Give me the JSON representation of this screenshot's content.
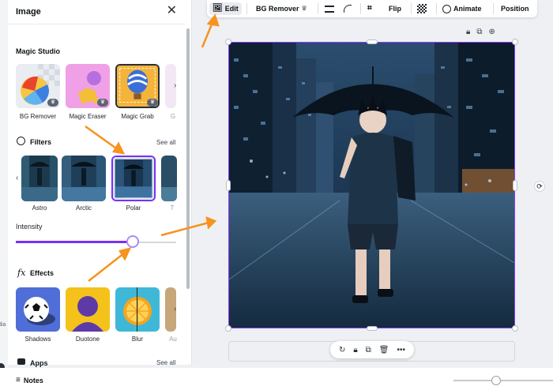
{
  "panel": {
    "title": "Image",
    "close_icon": "close-icon",
    "magic_studio": {
      "heading": "Magic Studio",
      "items": [
        {
          "label": "BG Remover"
        },
        {
          "label": "Magic Eraser"
        },
        {
          "label": "Magic Grab"
        },
        {
          "label": "G"
        }
      ]
    },
    "filters": {
      "heading": "Filters",
      "see_all": "See all",
      "items": [
        {
          "label": "Astro"
        },
        {
          "label": "Arctic"
        },
        {
          "label": "Polar"
        },
        {
          "label": "T"
        }
      ]
    },
    "intensity": {
      "label": "Intensity",
      "value_fraction": 0.73
    },
    "effects": {
      "heading": "Effects",
      "items": [
        {
          "label": "Shadows"
        },
        {
          "label": "Duotone"
        },
        {
          "label": "Blur"
        },
        {
          "label": "Au"
        }
      ]
    },
    "apps": {
      "heading": "Apps",
      "see_all": "See all"
    }
  },
  "toolbar": {
    "edit": "Edit",
    "bg_remover": "BG Remover",
    "flip": "Flip",
    "animate": "Animate",
    "position": "Position"
  },
  "left_strip": {
    "text": "dia"
  },
  "footer": {
    "notes": "Notes"
  },
  "colors": {
    "accent": "#8b3dff",
    "arrow": "#f7931e"
  }
}
